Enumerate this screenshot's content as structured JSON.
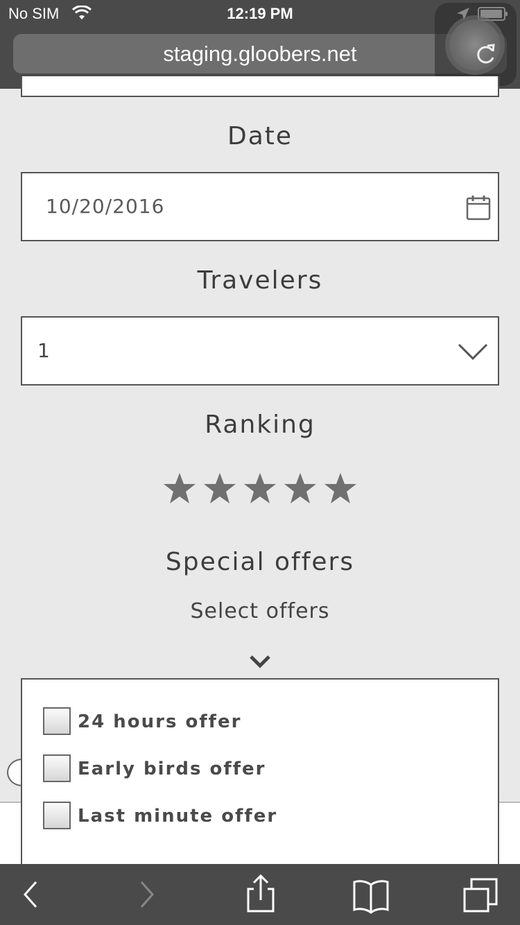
{
  "status_bar": {
    "carrier": "No SIM",
    "time": "12:19 PM"
  },
  "browser": {
    "url": "staging.gloobers.net"
  },
  "form": {
    "date": {
      "label": "Date",
      "value": "10/20/2016"
    },
    "travelers": {
      "label": "Travelers",
      "selected": "1"
    },
    "ranking": {
      "label": "Ranking",
      "stars_total": 5
    },
    "special_offers": {
      "label": "Special offers",
      "dropdown_label": "Select offers",
      "options": [
        {
          "label": "24 hours offer",
          "checked": false
        },
        {
          "label": "Early birds offer",
          "checked": false
        },
        {
          "label": "Last minute offer",
          "checked": false
        }
      ]
    }
  },
  "toolbar": {
    "icons": [
      "back-icon",
      "forward-icon",
      "share-icon",
      "bookmarks-icon",
      "tabs-icon"
    ]
  }
}
